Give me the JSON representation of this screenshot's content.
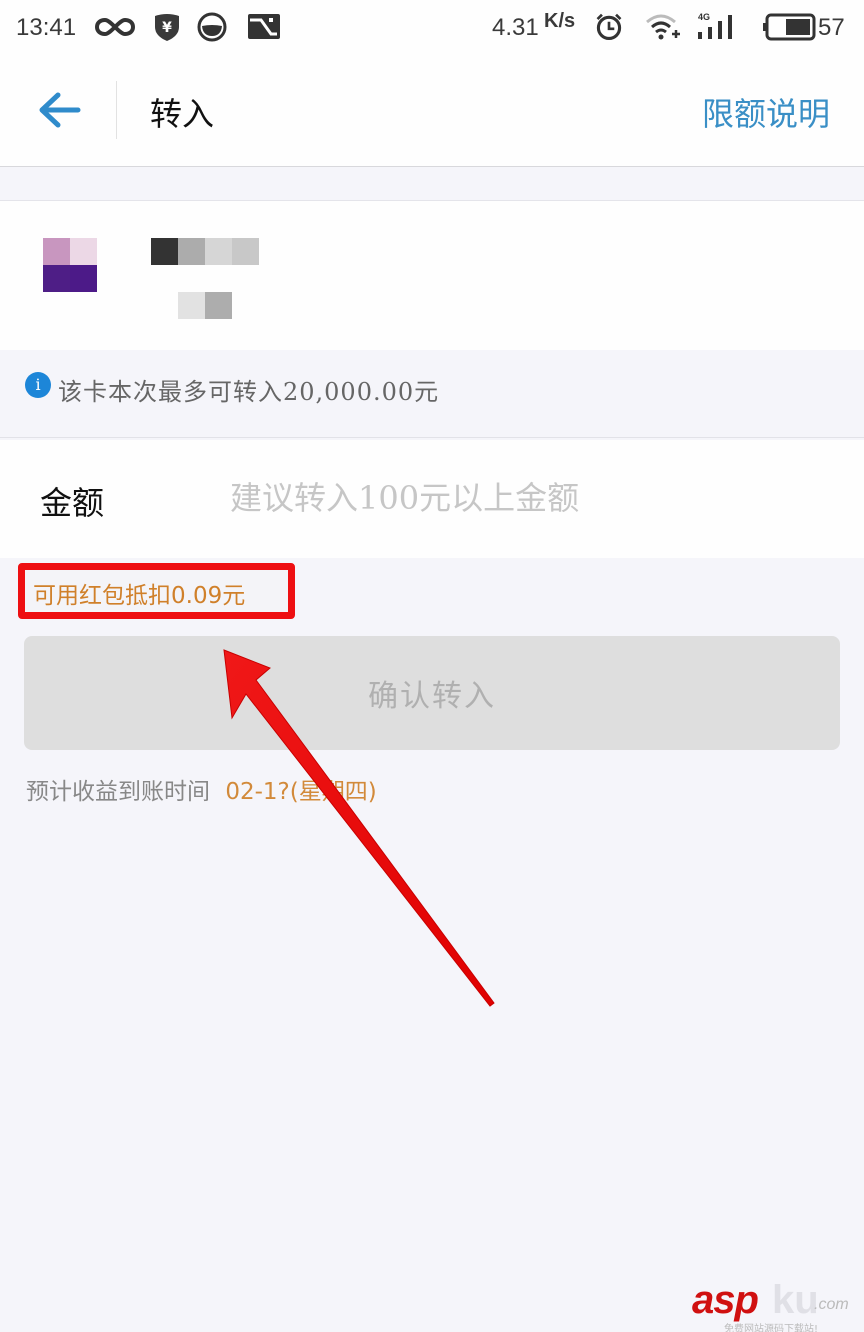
{
  "status_bar": {
    "time": "13:41",
    "icons_left": [
      "infinity-icon",
      "yen-shield-icon",
      "bowl-icon",
      "image-notification-icon"
    ],
    "network_speed": "4.31",
    "network_speed_unit": "K/s",
    "icons_right": [
      "alarm-clock-icon",
      "wifi-icon",
      "signal-4g-icon",
      "battery-icon"
    ],
    "network_type": "4G",
    "battery_percent": "57",
    "battery_level": 0.57
  },
  "nav": {
    "title": "转入",
    "right_link": "限额说明",
    "accent_color": "#3a8fc6"
  },
  "card": {
    "bank_logo": "pixelated-bank-logo",
    "bank_name": "[redacted]",
    "card_number": "[redacted]"
  },
  "info": {
    "icon_text": "i",
    "text": "该卡本次最多可转入20,000.00元"
  },
  "amount": {
    "label": "金额",
    "value": "",
    "placeholder": "建议转入100元以上金额"
  },
  "red_packet": {
    "text": "可用红包抵扣0.09元",
    "highlight_color": "#ee0f12"
  },
  "confirm_button": {
    "label": "确认转入",
    "disabled": true
  },
  "arrival": {
    "label": "预计收益到账时间",
    "value": "02-1?(星期四)"
  },
  "watermark": {
    "brand_red": "asp",
    "brand_gray": "ku",
    "domain": ".com",
    "tagline": "免费网站源码下载站!"
  }
}
